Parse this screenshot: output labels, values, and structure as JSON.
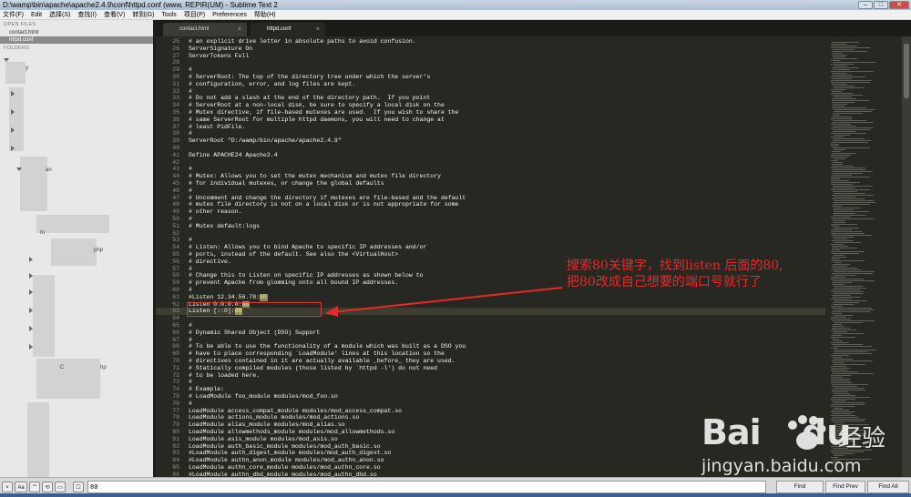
{
  "window": {
    "title": "D:\\wamp\\bin\\apache\\apache2.4.9\\conf\\httpd.conf (www, REPIR(UM) - Sublime Text 2",
    "controls": [
      "–",
      "□",
      "✕"
    ]
  },
  "menu": [
    "文件(F)",
    "Edit",
    "选择(S)",
    "查找(I)",
    "查看(V)",
    "转到(G)",
    "Tools",
    "项目(P)",
    "Preferences",
    "帮助(H)"
  ],
  "sidebar": {
    "open_files_header": "OPEN FILES",
    "open_files": [
      "contact.html",
      "httpd.conf"
    ],
    "folders_header": "FOLDERS",
    "tree_fragments": [
      "y",
      "an",
      "In",
      "php",
      "C",
      "hp"
    ]
  },
  "tabs": [
    {
      "label": "contact.html",
      "active": false
    },
    {
      "label": "httpd.conf",
      "active": true
    }
  ],
  "editor": {
    "lines": [
      {
        "n": "25",
        "t": "# an explicit drive letter in absolute paths to avoid confusion."
      },
      {
        "n": "26",
        "t": "ServerSignature On"
      },
      {
        "n": "27",
        "t": "ServerTokens Full"
      },
      {
        "n": "28",
        "t": ""
      },
      {
        "n": "29",
        "t": "#"
      },
      {
        "n": "30",
        "t": "# ServerRoot: The top of the directory tree under which the server's"
      },
      {
        "n": "31",
        "t": "# configuration, error, and log files are kept."
      },
      {
        "n": "32",
        "t": "#"
      },
      {
        "n": "33",
        "t": "# Do not add a slash at the end of the directory path.  If you point"
      },
      {
        "n": "34",
        "t": "# ServerRoot at a non-local disk, be sure to specify a local disk on the"
      },
      {
        "n": "35",
        "t": "# Mutex directive, if file-based mutexes are used.  If you wish to share the"
      },
      {
        "n": "36",
        "t": "# same ServerRoot for multiple httpd daemons, you will need to change at"
      },
      {
        "n": "37",
        "t": "# least PidFile."
      },
      {
        "n": "38",
        "t": "#"
      },
      {
        "n": "39",
        "t": "ServerRoot \"D:/wamp/bin/apache/apache2.4.9\""
      },
      {
        "n": "40",
        "t": ""
      },
      {
        "n": "41",
        "t": "Define APACHE24 Apache2.4"
      },
      {
        "n": "42",
        "t": ""
      },
      {
        "n": "43",
        "t": "#"
      },
      {
        "n": "44",
        "t": "# Mutex: Allows you to set the mutex mechanism and mutex file directory"
      },
      {
        "n": "45",
        "t": "# for individual mutexes, or change the global defaults"
      },
      {
        "n": "46",
        "t": "#"
      },
      {
        "n": "47",
        "t": "# Uncomment and change the directory if mutexes are file-based and the default"
      },
      {
        "n": "48",
        "t": "# mutex file directory is not on a local disk or is not appropriate for some"
      },
      {
        "n": "49",
        "t": "# other reason."
      },
      {
        "n": "50",
        "t": "#"
      },
      {
        "n": "51",
        "t": "# Mutex default:logs"
      },
      {
        "n": "52",
        "t": ""
      },
      {
        "n": "53",
        "t": "#"
      },
      {
        "n": "54",
        "t": "# Listen: Allows you to bind Apache to specific IP addresses and/or"
      },
      {
        "n": "55",
        "t": "# ports, instead of the default. See also the <VirtualHost>"
      },
      {
        "n": "56",
        "t": "# directive."
      },
      {
        "n": "57",
        "t": "#"
      },
      {
        "n": "58",
        "t": "# Change this to Listen on specific IP addresses as shown below to"
      },
      {
        "n": "59",
        "t": "# prevent Apache from glomming onto all bound IP addresses."
      },
      {
        "n": "60",
        "t": "#"
      },
      {
        "n": "61",
        "t": "#Listen 12.34.56.78:80"
      },
      {
        "n": "62",
        "t": "Listen 0.0.0.0:80"
      },
      {
        "n": "63",
        "t": "Listen [::0]:80"
      },
      {
        "n": "64",
        "t": ""
      },
      {
        "n": "65",
        "t": "#"
      },
      {
        "n": "66",
        "t": "# Dynamic Shared Object (DSO) Support"
      },
      {
        "n": "67",
        "t": "#"
      },
      {
        "n": "68",
        "t": "# To be able to use the functionality of a module which was built as a DSO you"
      },
      {
        "n": "69",
        "t": "# have to place corresponding `LoadModule' lines at this location so the"
      },
      {
        "n": "70",
        "t": "# directives contained in it are actually available _before_ they are used."
      },
      {
        "n": "71",
        "t": "# Statically compiled modules (those listed by `httpd -l') do not need"
      },
      {
        "n": "72",
        "t": "# to be loaded here."
      },
      {
        "n": "73",
        "t": "#"
      },
      {
        "n": "74",
        "t": "# Example:"
      },
      {
        "n": "75",
        "t": "# LoadModule foo_module modules/mod_foo.so"
      },
      {
        "n": "76",
        "t": "#"
      },
      {
        "n": "77",
        "t": "LoadModule access_compat_module modules/mod_access_compat.so"
      },
      {
        "n": "78",
        "t": "LoadModule actions_module modules/mod_actions.so"
      },
      {
        "n": "79",
        "t": "LoadModule alias_module modules/mod_alias.so"
      },
      {
        "n": "80",
        "t": "LoadModule allowmethods_module modules/mod_allowmethods.so"
      },
      {
        "n": "81",
        "t": "LoadModule asis_module modules/mod_asis.so"
      },
      {
        "n": "82",
        "t": "LoadModule auth_basic_module modules/mod_auth_basic.so"
      },
      {
        "n": "83",
        "t": "#LoadModule auth_digest_module modules/mod_auth_digest.so"
      },
      {
        "n": "84",
        "t": "#LoadModule authn_anon_module modules/mod_authn_anon.so"
      },
      {
        "n": "85",
        "t": "LoadModule authn_core_module modules/mod_authn_core.so"
      },
      {
        "n": "86",
        "t": "#LoadModule authn_dbd_module modules/mod_authn_dbd.so"
      }
    ]
  },
  "annotation": {
    "line1": "搜索80关键字，找到listen 后面的80,",
    "line2": "把80改成自己想要的端口号就行了"
  },
  "findbar": {
    "query": "80",
    "find_label": "Find",
    "find_prev_label": "Find Prev",
    "find_all_label": "Find All",
    "option_icons": [
      "Aa",
      "\"\"",
      "⟲",
      "▭",
      "☐"
    ]
  },
  "watermark": {
    "brand": "Bai",
    "brand_tail": "du",
    "cn": "经验",
    "url": "jingyan.baidu.com"
  },
  "colors": {
    "editor_bg": "#272822",
    "annotation_red": "#e42a2a",
    "highlight_yellow": "#e6db74"
  }
}
